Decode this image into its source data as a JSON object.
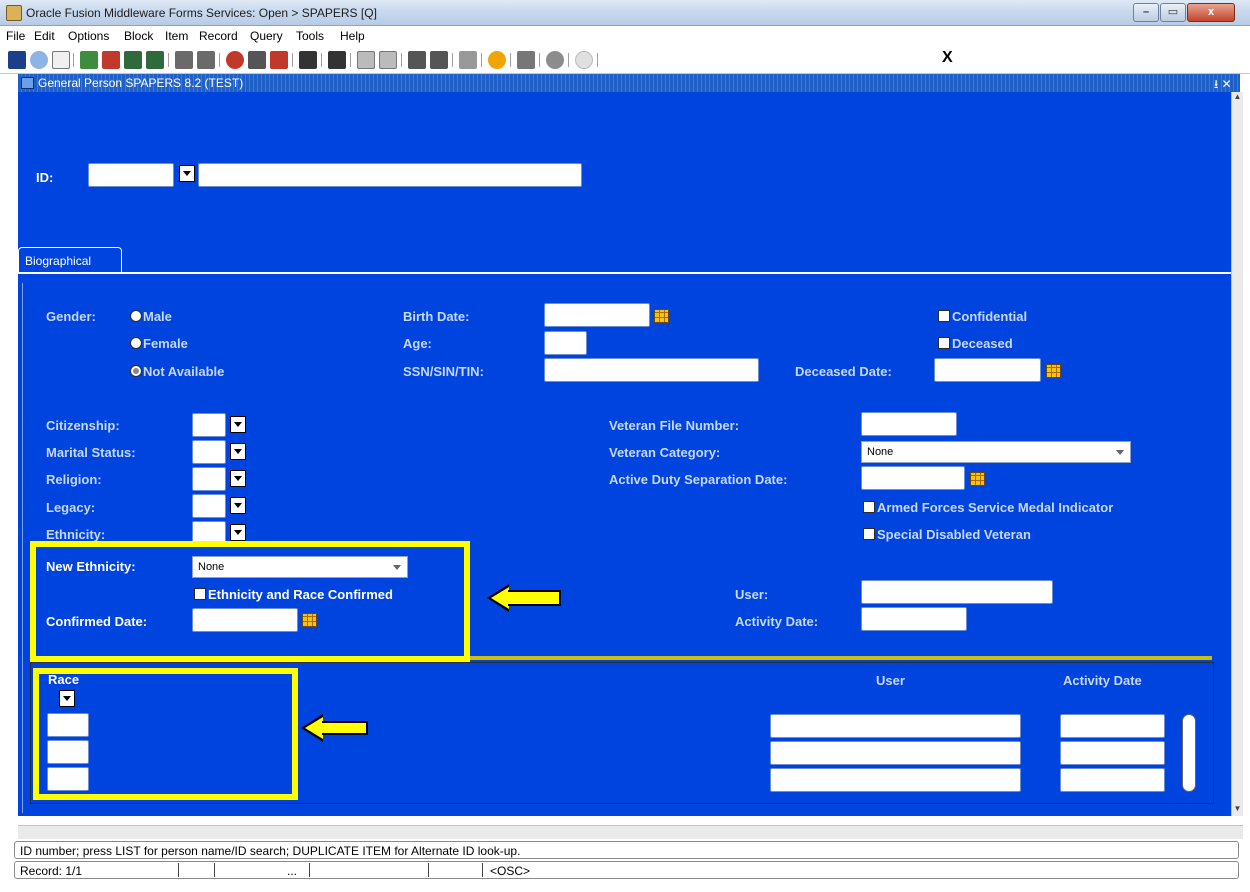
{
  "window": {
    "title": "Oracle Fusion Middleware Forms Services:  Open > SPAPERS [Q]",
    "controls": {
      "minimize": "–",
      "maximize": "▭",
      "close": "x"
    }
  },
  "menu": [
    "File",
    "Edit",
    "Options",
    "Block",
    "Item",
    "Record",
    "Query",
    "Tools",
    "Help"
  ],
  "toolbar": {
    "exit_label": "X",
    "icons": [
      "save-icon",
      "rollback-icon",
      "select-icon",
      "insert-record-icon",
      "remove-record-icon",
      "previous-block-icon",
      "next-block-icon",
      "enter-query-icon",
      "execute-query-icon",
      "clear-record-icon",
      "clear-block-icon",
      "clear-form-icon",
      "print-icon",
      "list-icon",
      "view-icon",
      "edit-icon",
      "duplicate-icon",
      "previous-record-icon",
      "next-record-icon",
      "help-icon",
      "hint-icon"
    ]
  },
  "form": {
    "title": "General Person  SPAPERS  8.2  (TEST)",
    "title_controls": "⭳ ✕",
    "key_block": {
      "id_label": "ID:",
      "id_value": "",
      "name_value": ""
    },
    "tab": "Biographical",
    "gender": {
      "label": "Gender:",
      "options": [
        "Male",
        "Female",
        "Not Available"
      ],
      "selected": "Not Available"
    },
    "birth_date_label": "Birth Date:",
    "age_label": "Age:",
    "ssn_label": "SSN/SIN/TIN:",
    "confidential_label": "Confidential",
    "deceased_label": "Deceased",
    "deceased_date_label": "Deceased Date:",
    "citizenship_label": "Citizenship:",
    "marital_status_label": "Marital Status:",
    "religion_label": "Religion:",
    "legacy_label": "Legacy:",
    "ethnicity_label": "Ethnicity:",
    "new_ethnicity_label": "New Ethnicity:",
    "new_ethnicity_value": "None",
    "ethnicity_race_confirmed_label": "Ethnicity and Race Confirmed",
    "confirmed_date_label": "Confirmed Date:",
    "veteran_file_number_label": "Veteran File Number:",
    "veteran_category_label": "Veteran Category:",
    "veteran_category_value": "None",
    "active_duty_sep_label": "Active Duty Separation Date:",
    "armed_forces_medal_label": "Armed Forces Service Medal Indicator",
    "special_disabled_vet_label": "Special Disabled Veteran",
    "user_label": "User:",
    "activity_date_label": "Activity Date:",
    "race_block": {
      "race_header": "Race",
      "user_header": "User",
      "activity_date_header": "Activity Date",
      "rows": [
        {
          "race": "",
          "user": "",
          "activity_date": ""
        },
        {
          "race": "",
          "user": "",
          "activity_date": ""
        },
        {
          "race": "",
          "user": "",
          "activity_date": ""
        }
      ]
    }
  },
  "status": {
    "hint": "ID number; press LIST for person name/ID search; DUPLICATE ITEM for Alternate ID look-up.",
    "record": "Record: 1/1",
    "list_indicator": "...",
    "osc": "<OSC>"
  },
  "colors": {
    "canvas": "#0044e0",
    "highlight": "#ffff00",
    "label": "#c7d8ff"
  }
}
